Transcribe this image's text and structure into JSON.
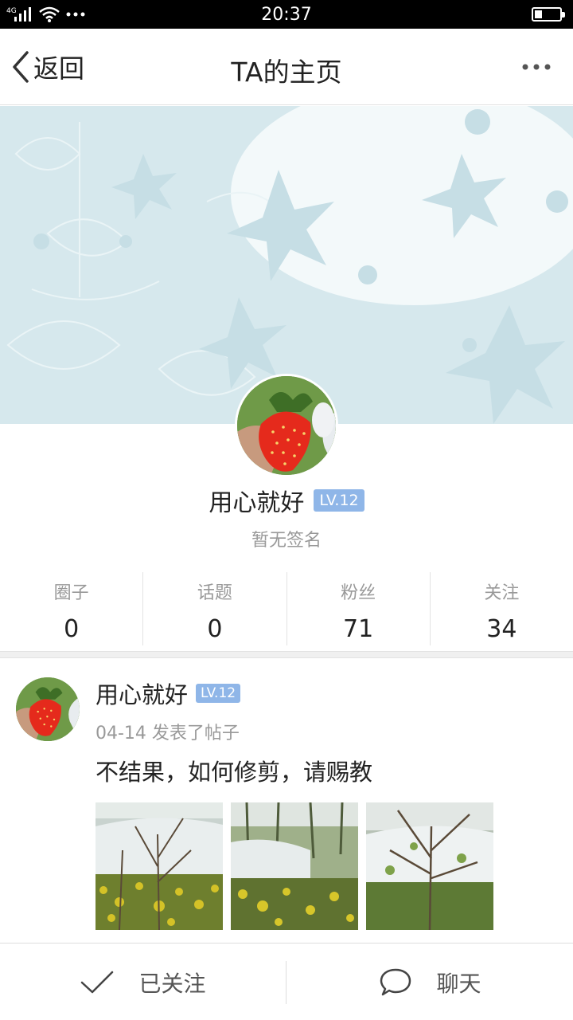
{
  "status_bar": {
    "network": "4G",
    "time": "20:37",
    "battery_level": 0.3
  },
  "nav": {
    "back_label": "返回",
    "title": "TA的主页"
  },
  "profile": {
    "name": "用心就好",
    "level": "LV.12",
    "signature": "暂无签名"
  },
  "stats": [
    {
      "label": "圈子",
      "value": "0"
    },
    {
      "label": "话题",
      "value": "0"
    },
    {
      "label": "粉丝",
      "value": "71"
    },
    {
      "label": "关注",
      "value": "34"
    }
  ],
  "post": {
    "author": "用心就好",
    "level": "LV.12",
    "meta": "04-14 发表了帖子",
    "title": "不结果，如何修剪，请赐教",
    "image_count": 3
  },
  "bottom_bar": {
    "follow_label": "已关注",
    "chat_label": "聊天"
  },
  "colors": {
    "level_badge": "#8fb6e8",
    "cover_bg": "#d6e8ed",
    "muted_text": "#999999"
  }
}
